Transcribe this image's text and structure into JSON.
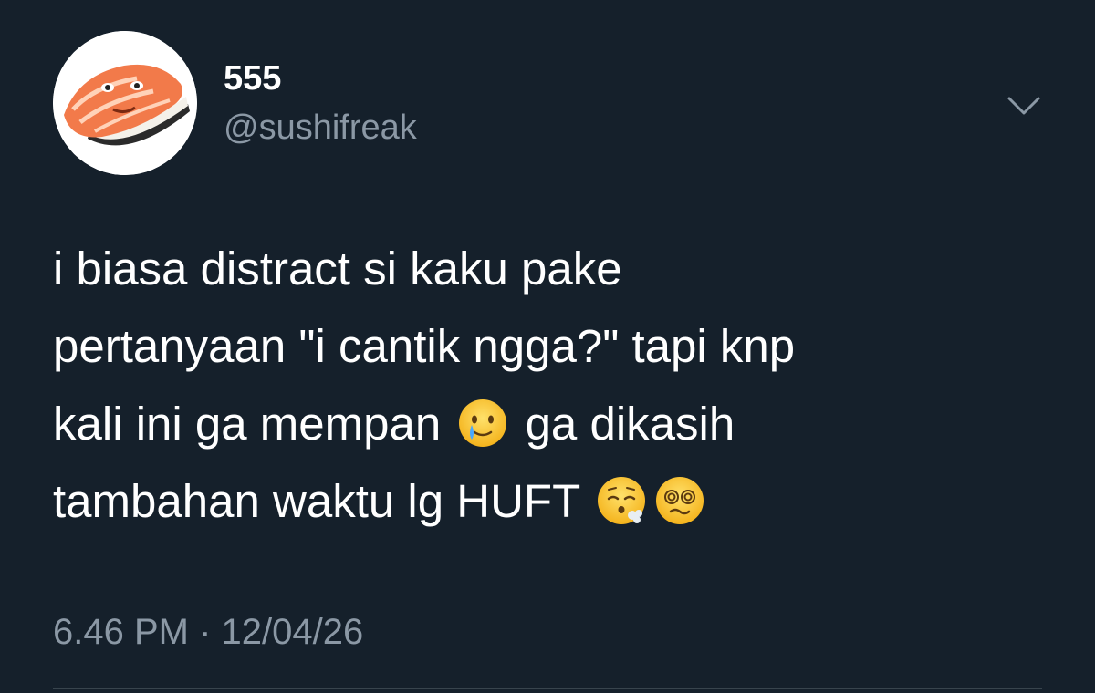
{
  "author": {
    "display_name": "555",
    "handle": "@sushifreak",
    "avatar_icon": "salmon-sushi-avatar"
  },
  "menu": {
    "icon": "chevron-down-icon"
  },
  "tweet": {
    "line1": "i biasa distract si kaku pake",
    "line2": "pertanyaan \"i cantik ngga?\" tapi knp",
    "line3_part1": "kali ini ga mempan",
    "line3_part2": "ga dikasih",
    "line4": "tambahan waktu lg HUFT",
    "emojis": [
      "face-holding-back-tears",
      "face-exhaling",
      "face-with-spiral-eyes"
    ]
  },
  "meta": {
    "time": "6.46 PM",
    "separator": "·",
    "date": "12/04/26"
  },
  "colors": {
    "background": "#15202b",
    "text": "#ffffff",
    "secondary_text": "#8b98a5",
    "divider": "#38444d"
  }
}
